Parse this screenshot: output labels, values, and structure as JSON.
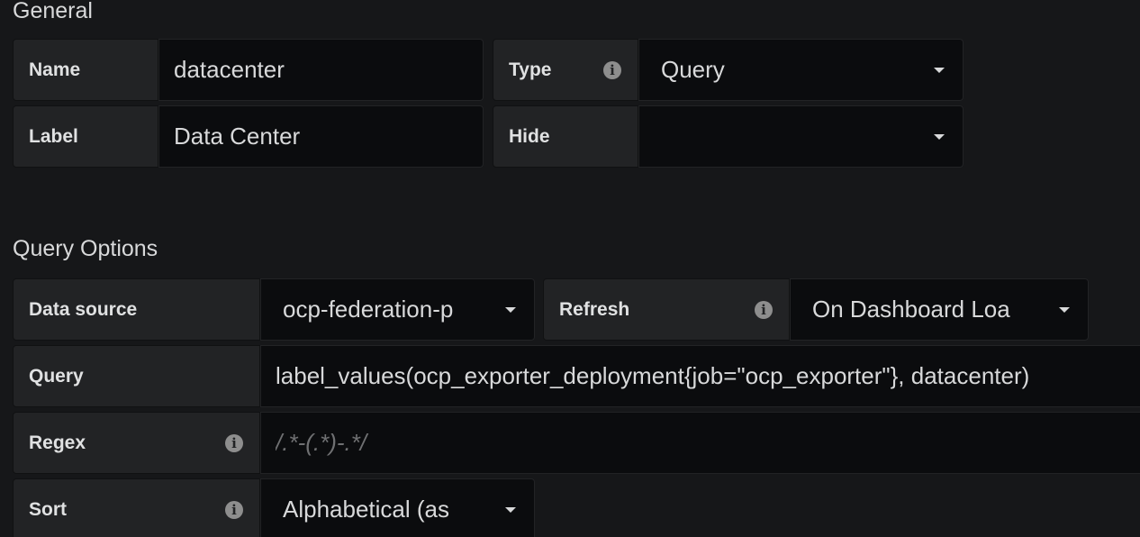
{
  "general": {
    "title": "General",
    "name_label": "Name",
    "name_value": "datacenter",
    "type_label": "Type",
    "type_value": "Query",
    "label_label": "Label",
    "label_value": "Data Center",
    "hide_label": "Hide",
    "hide_value": ""
  },
  "query_options": {
    "title": "Query Options",
    "datasource_label": "Data source",
    "datasource_value": "ocp-federation-p",
    "refresh_label": "Refresh",
    "refresh_value": "On Dashboard Loa",
    "query_label": "Query",
    "query_value": "label_values(ocp_exporter_deployment{job=\"ocp_exporter\"}, datacenter)",
    "regex_label": "Regex",
    "regex_placeholder": "/.*-(.*)-.*/",
    "sort_label": "Sort",
    "sort_value": "Alphabetical (as"
  },
  "icons": {
    "info": "info-icon",
    "dropdown": "caret-down-icon"
  },
  "colors": {
    "background": "#161719",
    "label_bg": "#222325",
    "input_bg": "#0b0c0e",
    "text": "#d8d9da"
  }
}
